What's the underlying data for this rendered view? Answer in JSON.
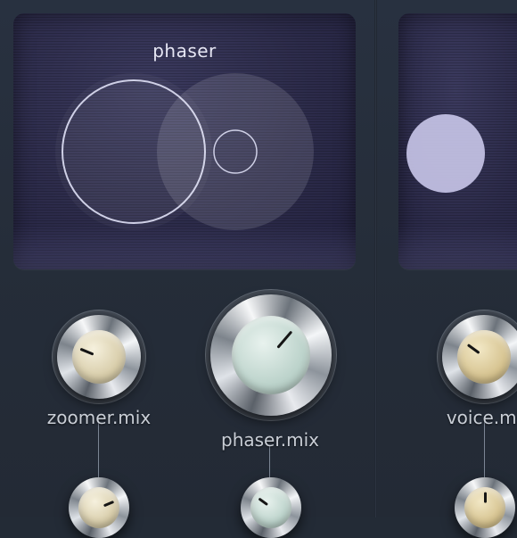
{
  "modules": [
    {
      "title": "phaser"
    },
    {
      "title": ""
    }
  ],
  "knobs": {
    "zoomer_mix": {
      "label": "zoomer.mix",
      "value": 0.25
    },
    "phaser_mix": {
      "label": "phaser.mix",
      "value": 0.65
    },
    "voice_mix": {
      "label": "voice.mi",
      "value": 0.3
    },
    "zoomer_sub": {
      "value": 0.75
    },
    "phaser_sub": {
      "value": 0.3
    },
    "voice_sub": {
      "value": 0.5
    }
  },
  "colors": {
    "background": "#232b36",
    "screen": "#2c2b4a",
    "cap_cream": "#d8cdaa",
    "cap_mint": "#bcd3cb",
    "cap_gold": "#d6c390"
  }
}
